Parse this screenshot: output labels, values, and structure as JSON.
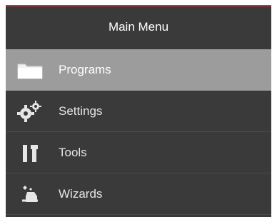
{
  "menu": {
    "title": "Main Menu",
    "items": [
      {
        "label": "Programs",
        "icon": "folder-icon",
        "active": true
      },
      {
        "label": "Settings",
        "icon": "gears-icon",
        "active": false
      },
      {
        "label": "Tools",
        "icon": "tools-icon",
        "active": false
      },
      {
        "label": "Wizards",
        "icon": "wizard-icon",
        "active": false
      }
    ]
  },
  "colors": {
    "panel": "#3a3a3a",
    "active_bg": "#9c9c9c",
    "accent_top": "#c0323a",
    "text": "#ffffff"
  }
}
